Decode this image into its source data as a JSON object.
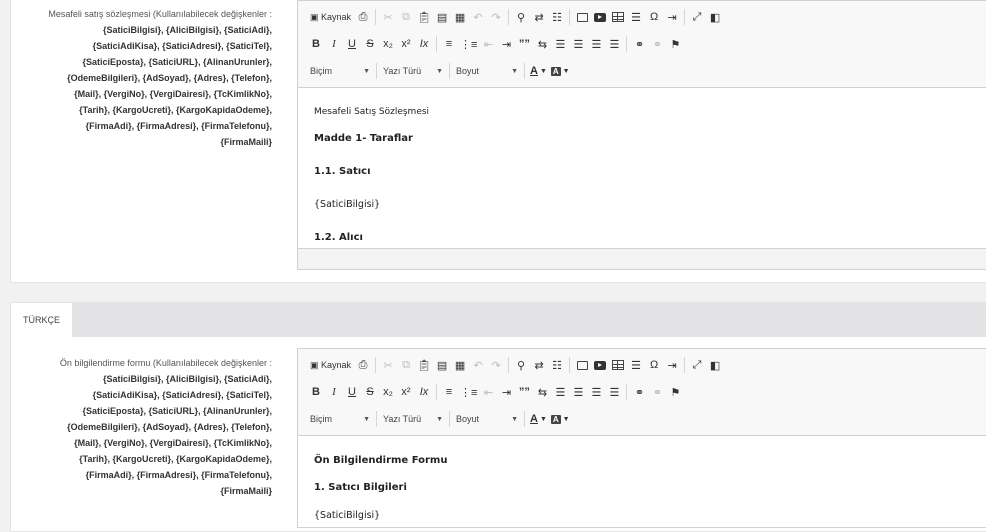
{
  "section1": {
    "label_title": "Mesafeli satış sözleşmesi (Kullanılabilecek değişkenler :",
    "label_vars": [
      "{SaticiBilgisi}, {AliciBilgisi}, {SaticiAdi},",
      "{SaticiAdiKisa}, {SaticiAdresi}, {SaticiTel},",
      "{SaticiEposta}, {SaticiURL}, {AlinanUrunler},",
      "{OdemeBilgileri}, {AdSoyad}, {Adres}, {Telefon},",
      "{Mail}, {VergiNo}, {VergiDairesi}, {TcKimlikNo},",
      "{Tarih}, {KargoUcreti}, {KargoKapidaOdeme},",
      "{FirmaAdi}, {FirmaAdresi}, {FirmaTelefonu},",
      "{FirmaMaili}"
    ],
    "content": [
      "Mesafeli Satış Sözleşmesi",
      "Madde 1- Taraflar",
      "1.1. Satıcı",
      "{SaticiBilgisi}",
      "1.2. Alıcı"
    ]
  },
  "tab": {
    "label": "TÜRKÇE"
  },
  "section2": {
    "label_title": "Ön bilgilendirme formu (Kullanılabilecek değişkenler :",
    "label_vars": [
      "{SaticiBilgisi}, {AliciBilgisi}, {SaticiAdi},",
      "{SaticiAdiKisa}, {SaticiAdresi}, {SaticiTel},",
      "{SaticiEposta}, {SaticiURL}, {AlinanUrunler},",
      "{OdemeBilgileri}, {AdSoyad}, {Adres}, {Telefon},",
      "{Mail}, {VergiNo}, {VergiDairesi}, {TcKimlikNo},",
      "{Tarih}, {KargoUcreti}, {KargoKapidaOdeme},",
      "{FirmaAdi}, {FirmaAdresi}, {FirmaTelefonu},",
      "{FirmaMaili}"
    ],
    "content": [
      "Ön Bilgilendirme Formu",
      "1. Satıcı Bilgileri",
      "{SaticiBilgisi}"
    ]
  },
  "toolbar": {
    "source_label": "Kaynak",
    "format_label": "Biçim",
    "font_label": "Yazı Türü",
    "size_label": "Boyut",
    "bold": "B",
    "italic": "I",
    "underline": "U",
    "strike": "S",
    "subscript": "x₂",
    "superscript": "x²",
    "remove_format": "Ix",
    "blockquote": "””",
    "omega": "Ω",
    "text_color": "A",
    "bg_color": "A",
    "icons": {
      "source": "source-icon",
      "print": "print-icon",
      "cut": "cut-icon",
      "copy": "copy-icon",
      "paste": "paste-icon",
      "paste_text": "paste-text-icon",
      "paste_word": "paste-word-icon",
      "undo": "undo-icon",
      "redo": "redo-icon",
      "find": "find-icon",
      "replace": "replace-icon",
      "select_all": "select-all-icon",
      "image": "image-icon",
      "video": "video-icon",
      "table": "table-icon",
      "hr": "horizontal-rule-icon",
      "special_char": "omega-icon",
      "page_break": "page-break-icon",
      "maximize": "maximize-icon",
      "show_blocks": "show-blocks-icon",
      "numbered_list": "numbered-list-icon",
      "bullet_list": "bullet-list-icon",
      "outdent": "outdent-icon",
      "indent": "indent-icon",
      "bidi": "bidi-icon",
      "align_left": "align-left-icon",
      "align_center": "align-center-icon",
      "align_right": "align-right-icon",
      "justify": "justify-icon",
      "link": "link-icon",
      "unlink": "unlink-icon",
      "anchor": "anchor-flag-icon"
    }
  }
}
